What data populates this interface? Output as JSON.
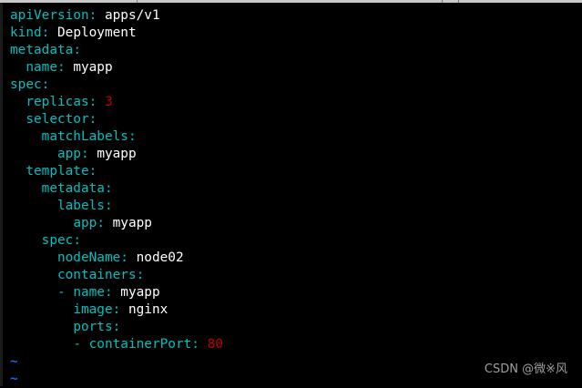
{
  "editor": {
    "lines": [
      {
        "indent": "",
        "dash": "",
        "key": "apiVersion",
        "value": " apps/v1",
        "vtype": "str"
      },
      {
        "indent": "",
        "dash": "",
        "key": "kind",
        "value": " Deployment",
        "vtype": "str"
      },
      {
        "indent": "",
        "dash": "",
        "key": "metadata",
        "value": "",
        "vtype": "str"
      },
      {
        "indent": "  ",
        "dash": "",
        "key": "name",
        "value": " myapp",
        "vtype": "str"
      },
      {
        "indent": "",
        "dash": "",
        "key": "spec",
        "value": "",
        "vtype": "str"
      },
      {
        "indent": "  ",
        "dash": "",
        "key": "replicas",
        "value": " 3",
        "vtype": "num"
      },
      {
        "indent": "  ",
        "dash": "",
        "key": "selector",
        "value": "",
        "vtype": "str"
      },
      {
        "indent": "    ",
        "dash": "",
        "key": "matchLabels",
        "value": "",
        "vtype": "str"
      },
      {
        "indent": "      ",
        "dash": "",
        "key": "app",
        "value": " myapp",
        "vtype": "str"
      },
      {
        "indent": "  ",
        "dash": "",
        "key": "template",
        "value": "",
        "vtype": "str"
      },
      {
        "indent": "    ",
        "dash": "",
        "key": "metadata",
        "value": "",
        "vtype": "str"
      },
      {
        "indent": "      ",
        "dash": "",
        "key": "labels",
        "value": "",
        "vtype": "str"
      },
      {
        "indent": "        ",
        "dash": "",
        "key": "app",
        "value": " myapp",
        "vtype": "str"
      },
      {
        "indent": "    ",
        "dash": "",
        "key": "spec",
        "value": "",
        "vtype": "str"
      },
      {
        "indent": "      ",
        "dash": "",
        "key": "nodeName",
        "value": " node02",
        "vtype": "str"
      },
      {
        "indent": "      ",
        "dash": "",
        "key": "containers",
        "value": "",
        "vtype": "str"
      },
      {
        "indent": "      ",
        "dash": "- ",
        "key": "name",
        "value": " myapp",
        "vtype": "str"
      },
      {
        "indent": "        ",
        "dash": "",
        "key": "image",
        "value": " nginx",
        "vtype": "str"
      },
      {
        "indent": "        ",
        "dash": "",
        "key": "ports",
        "value": "",
        "vtype": "str"
      },
      {
        "indent": "        ",
        "dash": "- ",
        "key": "containerPort",
        "value": " 80",
        "vtype": "num"
      }
    ],
    "empty_lines": [
      "~",
      "~"
    ]
  },
  "watermark": "CSDN @微※风",
  "colors": {
    "background": "#000000",
    "key": "#00c0c0",
    "value": "#ffffff",
    "number": "#c00000",
    "tilde": "#0070ff"
  }
}
